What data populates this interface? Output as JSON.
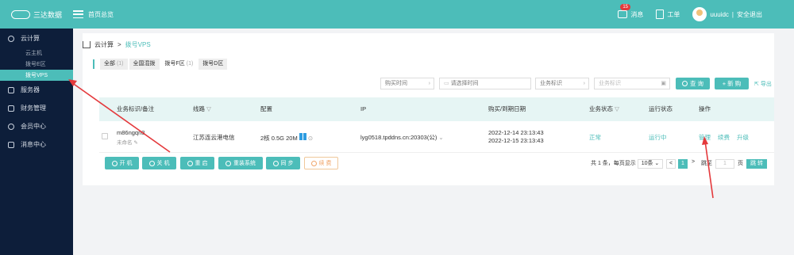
{
  "topbar": {
    "logo_text": "三达数据",
    "overview_label": "首页总览",
    "messages_label": "消息",
    "messages_badge": "15",
    "orders_label": "工单",
    "username": "uuuidc",
    "separator": "|",
    "logout_label": "安全退出"
  },
  "sidebar": {
    "items": [
      {
        "label": "云计算",
        "icon": "cloud-icon"
      },
      {
        "label": "服务器",
        "icon": "server-icon"
      },
      {
        "label": "财务管理",
        "icon": "finance-icon"
      },
      {
        "label": "会员中心",
        "icon": "user-icon"
      },
      {
        "label": "消息中心",
        "icon": "message-icon"
      }
    ],
    "sub_items": [
      "云主机",
      "拨号E区",
      "拨号VPS"
    ]
  },
  "breadcrumb": {
    "root": "云计算",
    "sep": ">",
    "current": "拨号VPS"
  },
  "tabs": [
    {
      "label": "全部",
      "count": "(1)"
    },
    {
      "label": "全国混拨",
      "count": ""
    },
    {
      "label": "拨号F区",
      "count": "(1)"
    },
    {
      "label": "拨号D区",
      "count": ""
    }
  ],
  "filters": {
    "purchase_time": "购买时间",
    "date_placeholder": "请选择时间",
    "biz_id_select": "业务标识",
    "biz_id_placeholder": "业务标识",
    "search_label": "查 询",
    "new_label": "+ 新 购",
    "export_label": "导出"
  },
  "table": {
    "headers": [
      "业务标识/备注",
      "线路",
      "配置",
      "IP",
      "购买/到期日期",
      "业务状态",
      "运行状态",
      "操作"
    ],
    "row": {
      "biz_id": "m86ngqn3",
      "remark": "未命名",
      "line": "江苏连云港电信",
      "config": "2核  0.5G  20M",
      "ip": "lyg0518.tpddns.cn:20303(公)",
      "purchase_date": "2022-12-14 23:13:43",
      "expire_date": "2022-12-15 23:13:43",
      "biz_status": "正常",
      "run_status": "运行中",
      "ops": [
        "管理",
        "续费",
        "升级"
      ]
    }
  },
  "actions": [
    "开 机",
    "关 机",
    "重 启",
    "重装系统",
    "同 步",
    "续 费"
  ],
  "pager": {
    "summary": "共 1 条，每页显示",
    "per_page": "10条",
    "prev": "<",
    "page": "1",
    "next": ">",
    "goto_label": "跳至",
    "goto_value": "1",
    "page_unit": "页",
    "jump_label": "跳 转"
  },
  "colors": {
    "accent": "#4cbdb9",
    "sidebar_bg": "#0d1e3a",
    "arrow": "#e4393c"
  }
}
